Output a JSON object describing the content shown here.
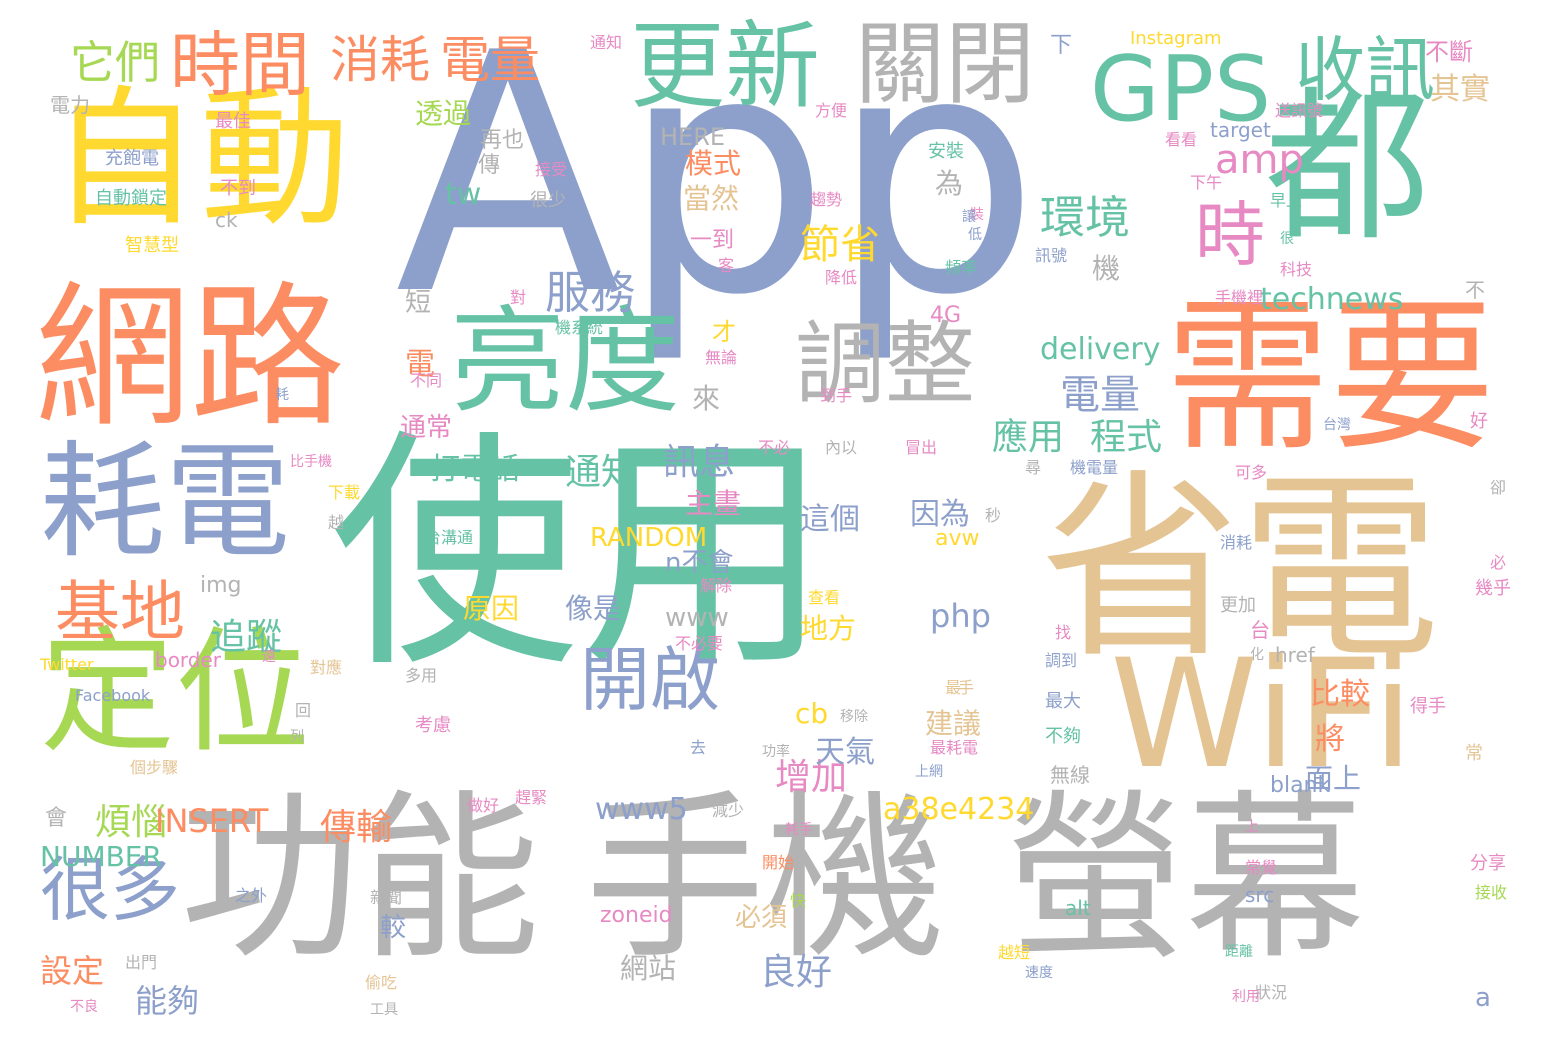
{
  "palette": {
    "teal": "#66c2a5",
    "orange": "#fc8d62",
    "blue": "#8da0cb",
    "pink": "#e78ac3",
    "green": "#a6d854",
    "yellow": "#ffd92f",
    "tan": "#e5c494",
    "gray": "#b3b3b3"
  },
  "words": [
    {
      "t": "App",
      "c": "blue"
    },
    {
      "t": "使用",
      "c": "teal"
    },
    {
      "t": "功能",
      "c": "gray"
    },
    {
      "t": "手機",
      "c": "gray"
    },
    {
      "t": "螢幕",
      "c": "gray"
    },
    {
      "t": "省電",
      "c": "tan"
    },
    {
      "t": "WiFi",
      "c": "tan"
    },
    {
      "t": "自動",
      "c": "yellow"
    },
    {
      "t": "網路",
      "c": "orange"
    },
    {
      "t": "都",
      "c": "teal"
    },
    {
      "t": "需要",
      "c": "orange"
    },
    {
      "t": "耗電",
      "c": "blue"
    },
    {
      "t": "定位",
      "c": "green"
    },
    {
      "t": "亮度",
      "c": "teal"
    },
    {
      "t": "更新",
      "c": "teal"
    },
    {
      "t": "關閉",
      "c": "gray"
    },
    {
      "t": "GPS",
      "c": "teal"
    },
    {
      "t": "收訊",
      "c": "teal"
    },
    {
      "t": "調整",
      "c": "gray"
    },
    {
      "t": "時間",
      "c": "orange"
    },
    {
      "t": "消耗",
      "c": "orange"
    },
    {
      "t": "電量",
      "c": "orange"
    },
    {
      "t": "它們",
      "c": "green"
    },
    {
      "t": "基地",
      "c": "orange"
    },
    {
      "t": "很多",
      "c": "blue"
    },
    {
      "t": "開啟",
      "c": "blue"
    },
    {
      "t": "時",
      "c": "pink"
    },
    {
      "t": "服務",
      "c": "blue"
    },
    {
      "t": "環境",
      "c": "teal"
    },
    {
      "t": "節省",
      "c": "yellow"
    },
    {
      "t": "amp",
      "c": "pink"
    },
    {
      "t": "tw",
      "c": "teal"
    },
    {
      "t": "透過",
      "c": "green"
    },
    {
      "t": "再也",
      "c": "gray"
    },
    {
      "t": "傳",
      "c": "gray"
    },
    {
      "t": "模式",
      "c": "orange"
    },
    {
      "t": "當然",
      "c": "tan"
    },
    {
      "t": "一到",
      "c": "pink"
    },
    {
      "t": "為",
      "c": "gray"
    },
    {
      "t": "機",
      "c": "gray"
    },
    {
      "t": "technews",
      "c": "teal"
    },
    {
      "t": "delivery",
      "c": "teal"
    },
    {
      "t": "電量",
      "c": "blue"
    },
    {
      "t": "應用",
      "c": "teal"
    },
    {
      "t": "程式",
      "c": "teal"
    },
    {
      "t": "通知",
      "c": "teal"
    },
    {
      "t": "訊息",
      "c": "blue"
    },
    {
      "t": "打電話",
      "c": "teal"
    },
    {
      "t": "主畫",
      "c": "pink"
    },
    {
      "t": "RANDOM",
      "c": "yellow"
    },
    {
      "t": "n不會",
      "c": "blue"
    },
    {
      "t": "www",
      "c": "gray"
    },
    {
      "t": "這個",
      "c": "blue"
    },
    {
      "t": "因為",
      "c": "blue"
    },
    {
      "t": "php",
      "c": "blue"
    },
    {
      "t": "原因",
      "c": "yellow"
    },
    {
      "t": "像是",
      "c": "blue"
    },
    {
      "t": "追蹤",
      "c": "teal"
    },
    {
      "t": "傳輸",
      "c": "orange"
    },
    {
      "t": "煩惱",
      "c": "green"
    },
    {
      "t": "INSERT",
      "c": "orange"
    },
    {
      "t": "NUMBER",
      "c": "teal"
    },
    {
      "t": "設定",
      "c": "orange"
    },
    {
      "t": "能夠",
      "c": "blue"
    },
    {
      "t": "良好",
      "c": "blue"
    },
    {
      "t": "增加",
      "c": "pink"
    },
    {
      "t": "a38e4234",
      "c": "yellow"
    },
    {
      "t": "www5",
      "c": "blue"
    },
    {
      "t": "天氣",
      "c": "blue"
    },
    {
      "t": "cb",
      "c": "yellow"
    },
    {
      "t": "比較",
      "c": "orange"
    },
    {
      "t": "將",
      "c": "orange"
    },
    {
      "t": "面上",
      "c": "blue"
    },
    {
      "t": "地方",
      "c": "yellow"
    },
    {
      "t": "建議",
      "c": "tan"
    },
    {
      "t": "必須",
      "c": "tan"
    },
    {
      "t": "網站",
      "c": "gray"
    },
    {
      "t": "較",
      "c": "blue"
    },
    {
      "t": "zoneid",
      "c": "pink"
    },
    {
      "t": "4G",
      "c": "pink"
    },
    {
      "t": "來",
      "c": "gray"
    },
    {
      "t": "才",
      "c": "yellow"
    },
    {
      "t": "電",
      "c": "orange"
    },
    {
      "t": "短",
      "c": "gray"
    },
    {
      "t": "通常",
      "c": "pink"
    },
    {
      "t": "img",
      "c": "gray"
    },
    {
      "t": "border",
      "c": "pink"
    },
    {
      "t": "Twitter",
      "c": "yellow"
    },
    {
      "t": "Facebook",
      "c": "blue"
    },
    {
      "t": "HERE",
      "c": "gray"
    },
    {
      "t": "target",
      "c": "blue"
    },
    {
      "t": "Instagram",
      "c": "yellow"
    },
    {
      "t": "href",
      "c": "gray"
    },
    {
      "t": "blank",
      "c": "blue"
    },
    {
      "t": "src",
      "c": "blue"
    },
    {
      "t": "alt",
      "c": "teal"
    },
    {
      "t": "avw",
      "c": "yellow"
    },
    {
      "t": "a",
      "c": "blue"
    },
    {
      "t": "ck",
      "c": "gray"
    },
    {
      "t": "其實",
      "c": "tan"
    },
    {
      "t": "不斷",
      "c": "pink"
    },
    {
      "t": "下",
      "c": "blue"
    },
    {
      "t": "電力",
      "c": "gray"
    },
    {
      "t": "最佳",
      "c": "pink"
    },
    {
      "t": "充飽電",
      "c": "blue"
    },
    {
      "t": "自動鎖定",
      "c": "teal"
    },
    {
      "t": "智慧型",
      "c": "yellow"
    },
    {
      "t": "不到",
      "c": "pink"
    },
    {
      "t": "送訊號",
      "c": "pink"
    },
    {
      "t": "看看",
      "c": "pink"
    },
    {
      "t": "下午",
      "c": "pink"
    },
    {
      "t": "早上",
      "c": "teal"
    },
    {
      "t": "安裝",
      "c": "teal"
    },
    {
      "t": "通知",
      "c": "pink"
    },
    {
      "t": "方便",
      "c": "pink"
    },
    {
      "t": "接受",
      "c": "pink"
    },
    {
      "t": "很少",
      "c": "gray"
    },
    {
      "t": "趨勢",
      "c": "pink"
    },
    {
      "t": "降低",
      "c": "pink"
    },
    {
      "t": "頻率",
      "c": "teal"
    },
    {
      "t": "訊號",
      "c": "blue"
    },
    {
      "t": "科技",
      "c": "pink"
    },
    {
      "t": "手機裡",
      "c": "pink"
    },
    {
      "t": "不",
      "c": "gray"
    },
    {
      "t": "很",
      "c": "teal"
    },
    {
      "t": "好",
      "c": "pink"
    },
    {
      "t": "台灣",
      "c": "blue"
    },
    {
      "t": "可多",
      "c": "pink"
    },
    {
      "t": "卻",
      "c": "gray"
    },
    {
      "t": "必",
      "c": "pink"
    },
    {
      "t": "幾乎",
      "c": "pink"
    },
    {
      "t": "更加",
      "c": "gray"
    },
    {
      "t": "消耗",
      "c": "blue"
    },
    {
      "t": "化",
      "c": "gray"
    },
    {
      "t": "得手",
      "c": "pink"
    },
    {
      "t": "常",
      "c": "tan"
    },
    {
      "t": "分享",
      "c": "pink"
    },
    {
      "t": "接收",
      "c": "green"
    },
    {
      "t": "常覺",
      "c": "pink"
    },
    {
      "t": "距離",
      "c": "teal"
    },
    {
      "t": "狀況",
      "c": "gray"
    },
    {
      "t": "最大",
      "c": "blue"
    },
    {
      "t": "不夠",
      "c": "teal"
    },
    {
      "t": "找",
      "c": "pink"
    },
    {
      "t": "調到",
      "c": "blue"
    },
    {
      "t": "最耗電",
      "c": "pink"
    },
    {
      "t": "上網",
      "c": "blue"
    },
    {
      "t": "功率",
      "c": "gray"
    },
    {
      "t": "移除",
      "c": "gray"
    },
    {
      "t": "開始",
      "c": "orange"
    },
    {
      "t": "減少",
      "c": "gray"
    },
    {
      "t": "耗手",
      "c": "pink"
    },
    {
      "t": "做好",
      "c": "pink"
    },
    {
      "t": "趕緊",
      "c": "pink"
    },
    {
      "t": "考慮",
      "c": "pink"
    },
    {
      "t": "多用",
      "c": "gray"
    },
    {
      "t": "解除",
      "c": "pink"
    },
    {
      "t": "不必要",
      "c": "pink"
    },
    {
      "t": "去",
      "c": "blue"
    },
    {
      "t": "快",
      "c": "green"
    },
    {
      "t": "之外",
      "c": "blue"
    },
    {
      "t": "新聞",
      "c": "gray"
    },
    {
      "t": "出門",
      "c": "gray"
    },
    {
      "t": "偷吃",
      "c": "tan"
    },
    {
      "t": "工具",
      "c": "gray"
    },
    {
      "t": "不良",
      "c": "pink"
    },
    {
      "t": "利用",
      "c": "pink"
    },
    {
      "t": "越短",
      "c": "yellow"
    },
    {
      "t": "速度",
      "c": "blue"
    },
    {
      "t": "台溝通",
      "c": "teal"
    },
    {
      "t": "對應",
      "c": "tan"
    },
    {
      "t": "比手機",
      "c": "pink"
    },
    {
      "t": "下載",
      "c": "yellow"
    },
    {
      "t": "越",
      "c": "gray"
    },
    {
      "t": "不同",
      "c": "pink"
    },
    {
      "t": "無論",
      "c": "pink"
    },
    {
      "t": "到手",
      "c": "pink"
    },
    {
      "t": "機系統",
      "c": "teal"
    },
    {
      "t": "對",
      "c": "pink"
    },
    {
      "t": "耗",
      "c": "blue"
    },
    {
      "t": "不必",
      "c": "pink"
    },
    {
      "t": "內以",
      "c": "gray"
    },
    {
      "t": "查看",
      "c": "yellow"
    },
    {
      "t": "秒",
      "c": "gray"
    },
    {
      "t": "會",
      "c": "gray"
    },
    {
      "t": "個步驟",
      "c": "tan"
    },
    {
      "t": "無線",
      "c": "gray"
    },
    {
      "t": "台",
      "c": "pink"
    },
    {
      "t": "客",
      "c": "pink"
    },
    {
      "t": "最",
      "c": "tan"
    },
    {
      "t": "手",
      "c": "tan"
    },
    {
      "t": "冒出",
      "c": "pink"
    },
    {
      "t": "尋",
      "c": "gray"
    },
    {
      "t": "機電量",
      "c": "blue"
    },
    {
      "t": "列",
      "c": "gray"
    },
    {
      "t": "回",
      "c": "gray"
    },
    {
      "t": "遠",
      "c": "pink"
    },
    {
      "t": "上",
      "c": "pink"
    },
    {
      "t": "裝",
      "c": "pink"
    },
    {
      "t": "讓",
      "c": "blue"
    },
    {
      "t": "低",
      "c": "blue"
    }
  ]
}
